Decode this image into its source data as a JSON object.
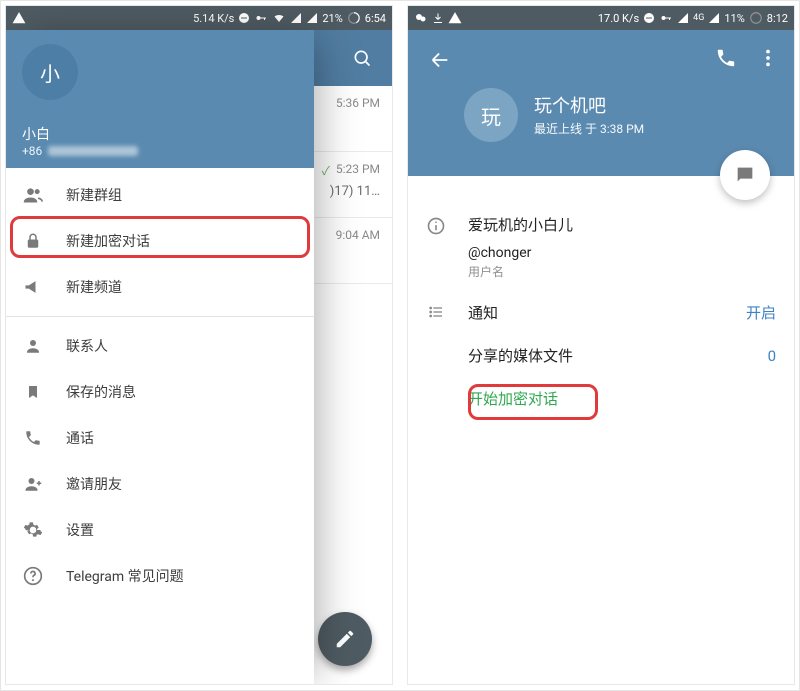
{
  "left": {
    "status": {
      "speed": "5.14 K/s",
      "battery": "21%",
      "time": "6:54"
    },
    "chat_times": [
      "5:36 PM",
      "5:23 PM",
      "9:04 AM"
    ],
    "chat_preview2": ")17) 11…",
    "drawer": {
      "avatar_letter": "小",
      "username": "小白",
      "phone_prefix": "+86",
      "items": {
        "new_group": "新建群组",
        "new_secret": "新建加密对话",
        "new_channel": "新建频道",
        "contacts": "联系人",
        "saved": "保存的消息",
        "calls": "通话",
        "invite": "邀请朋友",
        "settings": "设置",
        "faq": "Telegram 常见问题"
      }
    }
  },
  "right": {
    "status": {
      "speed": "17.0 K/s",
      "net": "4G",
      "battery": "11%",
      "time": "8:12"
    },
    "profile": {
      "avatar_letter": "玩",
      "name": "玩个机吧",
      "last_seen": "最近上线 于 3:38 PM",
      "bio": "爱玩机的小白儿",
      "handle": "@chonger",
      "handle_caption": "用户名",
      "notifications_label": "通知",
      "notifications_value": "开启",
      "media_label": "分享的媒体文件",
      "media_value": "0",
      "start_secret": "开始加密对话"
    }
  }
}
